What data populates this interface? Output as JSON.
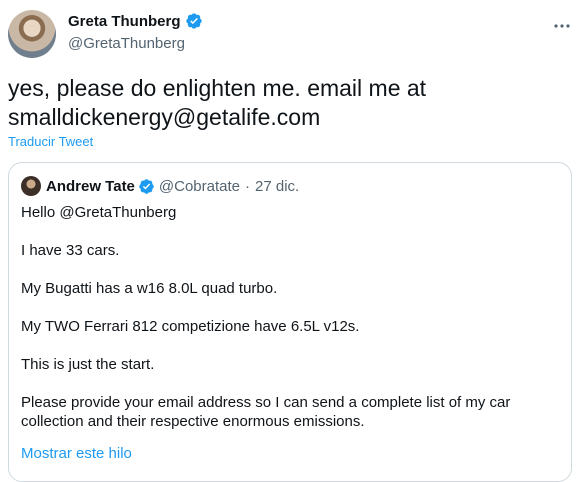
{
  "author": {
    "display_name": "Greta Thunberg",
    "handle": "@GretaThunberg",
    "verified": true
  },
  "tweet": {
    "text_line1": "yes, please do enlighten me. email me at",
    "text_line2": "smalldickenergy@getalife.com",
    "translate_label": "Traducir Tweet"
  },
  "quoted_tweet": {
    "display_name": "Andrew Tate",
    "handle": "@Cobratate",
    "separator": "·",
    "date": "27 dic.",
    "paragraphs": [
      "Hello @GretaThunberg",
      "I have 33 cars.",
      "My Bugatti has a w16 8.0L quad turbo.",
      "My TWO Ferrari 812 competizione have 6.5L v12s.",
      "This is just the start.",
      "Please provide your email address so I can send a complete list of my car collection and their respective enormous emissions."
    ],
    "show_thread_label": "Mostrar este hilo"
  },
  "colors": {
    "accent": "#1d9bf0",
    "text": "#0f1419",
    "muted": "#536471",
    "border": "#cfd9de"
  },
  "icons": {
    "verified": "verified-badge-icon",
    "more": "more-horizontal-icon"
  }
}
